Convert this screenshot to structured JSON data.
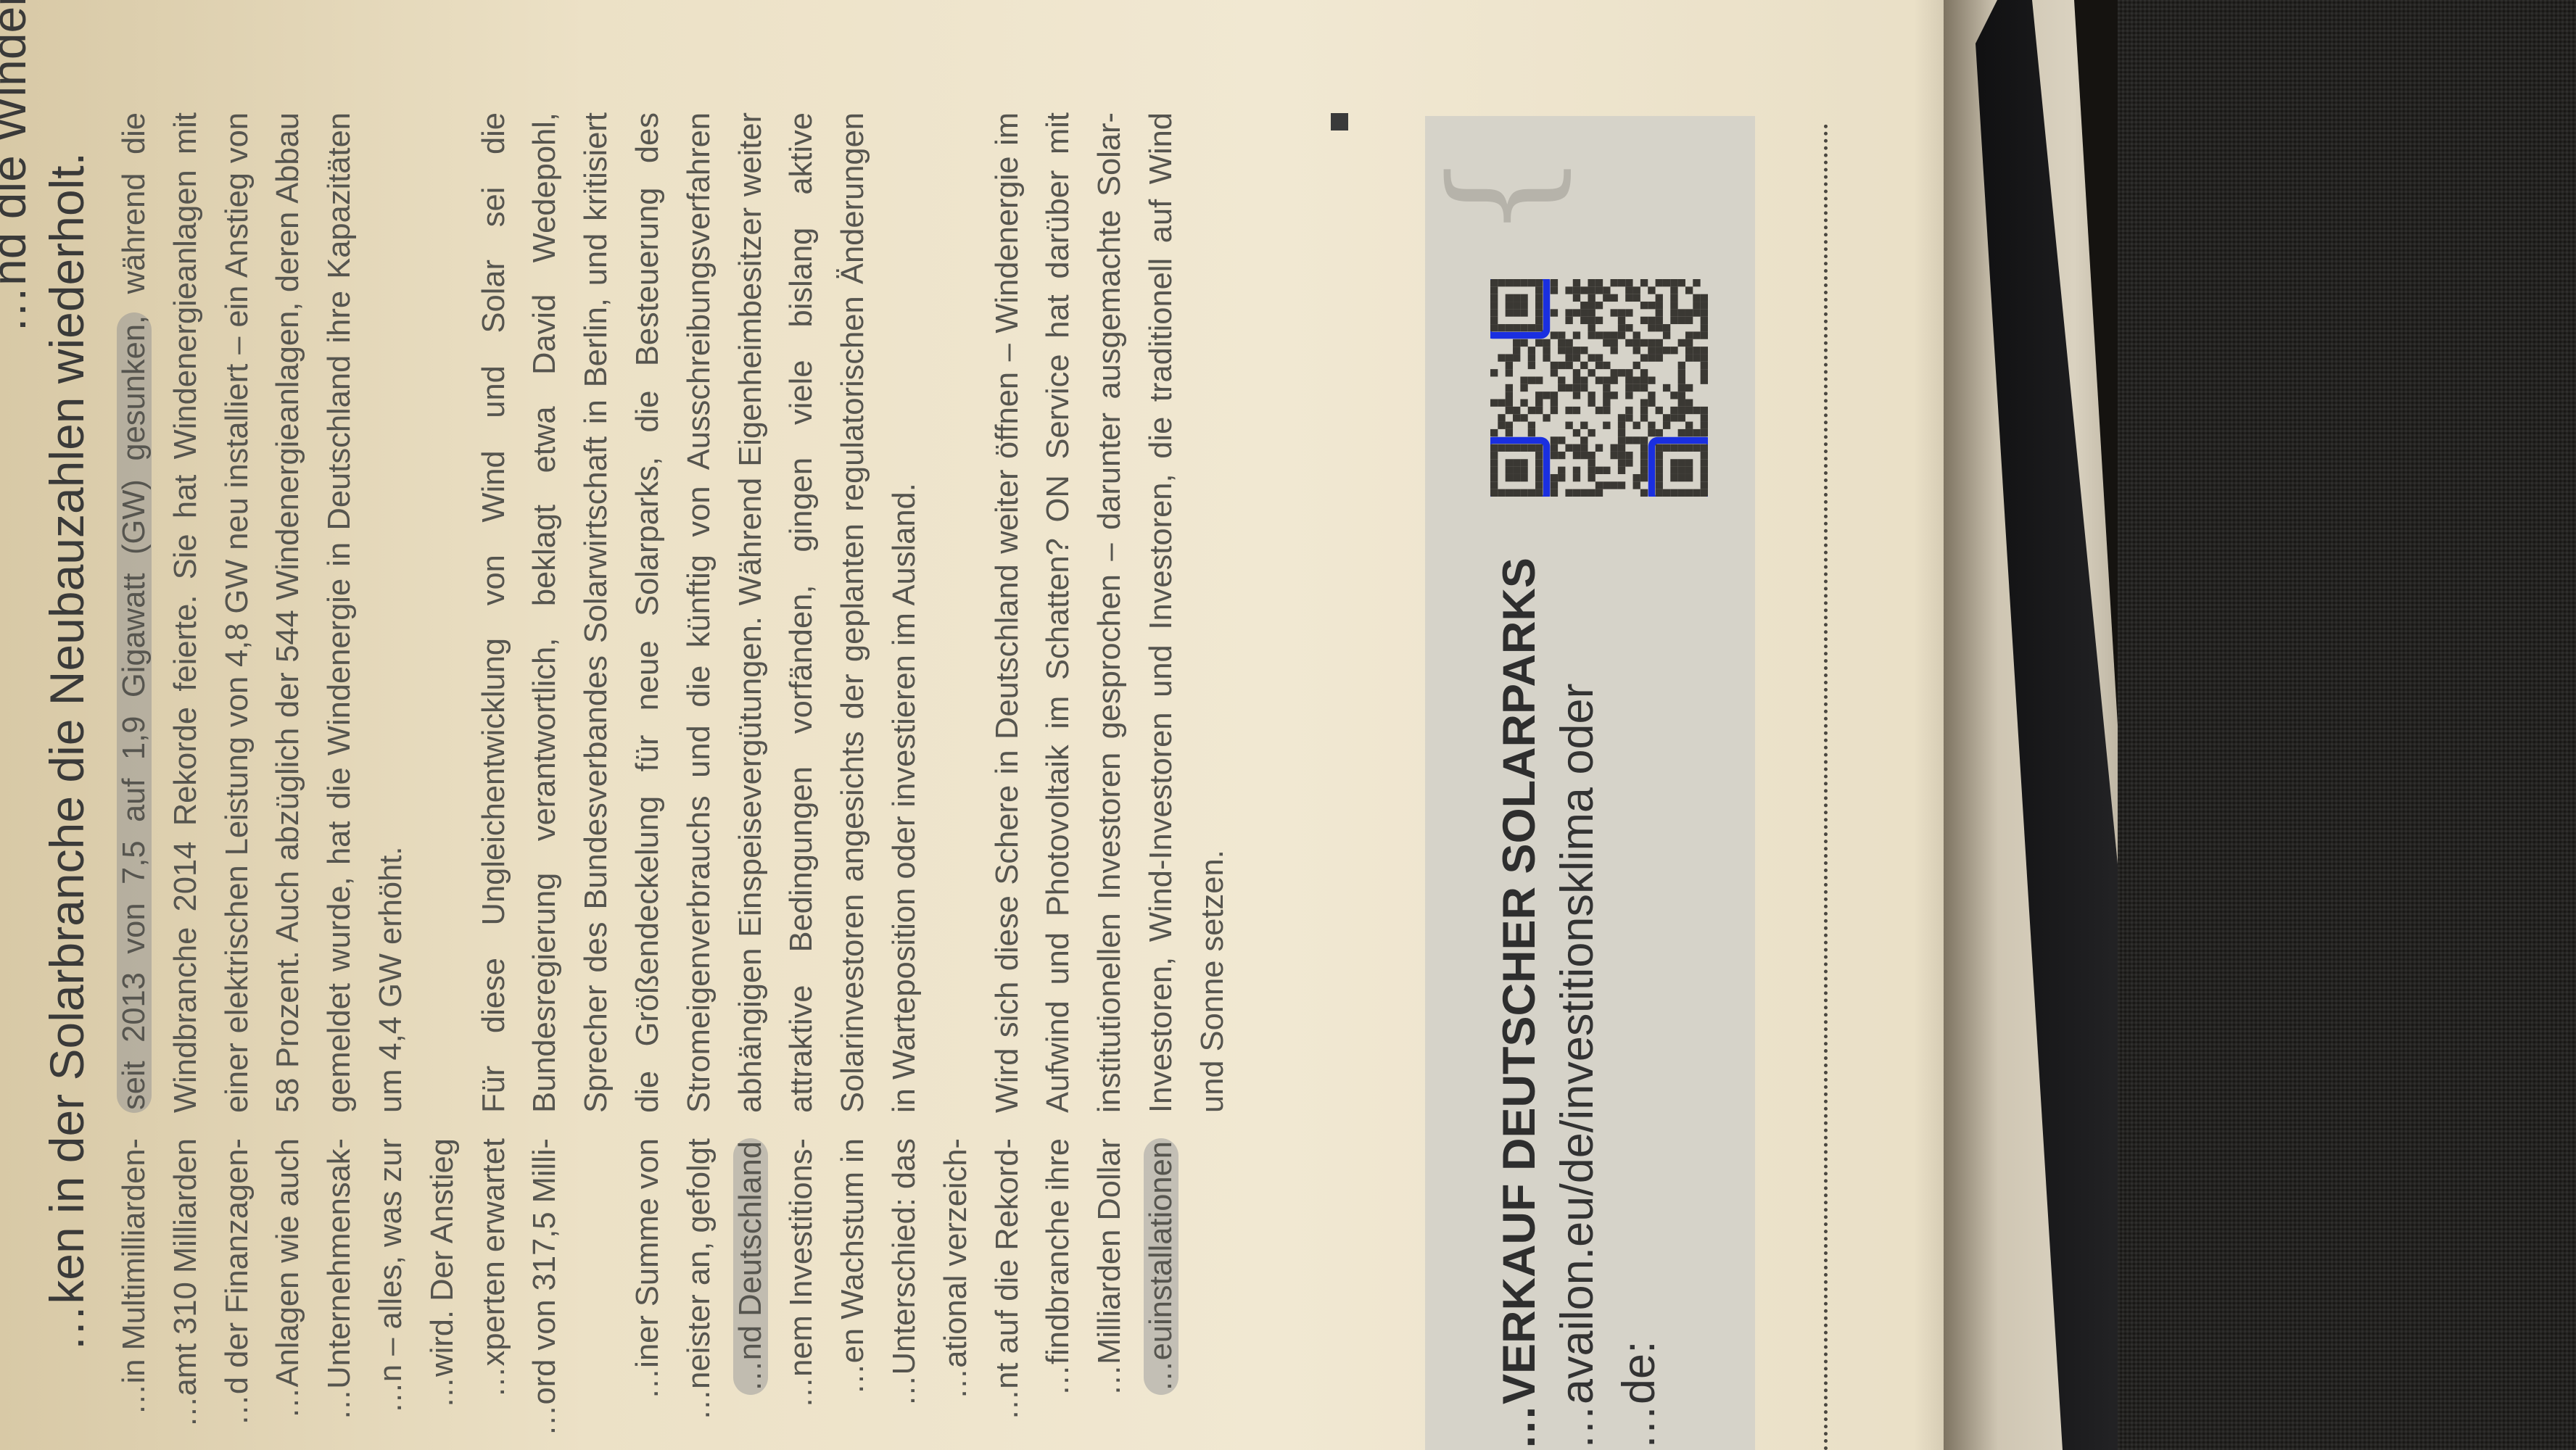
{
  "heading": {
    "line1": "…nd die Windenergiebranche in Deutsch-",
    "line2": "…ken in der Solarbranche die Neubauzahlen wiederholt."
  },
  "left_column": {
    "block1": [
      "…in Multimilliarden-",
      "…amt 310 Milliarden",
      "…d der Finanzagen-",
      "…Anlagen wie auch",
      "…Unternehmensak-",
      "…n – alles, was zur",
      "…wird. Der Anstieg",
      "…xperten erwartet",
      "…ord von 317,5 Milli-"
    ],
    "block2": [
      "…iner Summe von",
      "…neister an, gefolgt",
      "…nd Deutschland",
      "…nem Investitions-",
      "…en Wachstum in",
      "…Unterschied: das",
      "…ational verzeich-",
      "…nt auf die Rekord-",
      "…findbranche ihre",
      "…Milliarden Dollar",
      "…euinstallationen"
    ]
  },
  "right_column": {
    "para1_highlight": "seit 2013 von 7,5 auf 1,9 Gigawatt (GW) gesunken,",
    "para1_rest": " während die Windbranche 2014 Rekorde feierte. Sie hat Windenergieanlagen mit einer elektrischen Leistung von 4,8 GW neu installiert – ein Anstieg von 58 Prozent. Auch abzüglich der 544 Windenergieanlagen, deren Abbau gemeldet wurde, hat die Windenergie in Deutschland ihre Kapazitäten um 4,4 GW erhöht.",
    "para2": "Für diese Ungleichentwicklung von Wind und Solar sei die Bundesregierung verantwortlich, beklagt etwa David Wedepohl, Sprecher des Bundesverbandes Solarwirtschaft in Berlin, und kritisiert die Größendeckelung für neue Solarparks, die Besteuerung des Stromeigenverbrauchs und die künftig von Ausschreibungsverfahren abhängigen Einspeisevergütungen. Während Eigenheimbesitzer weiter attraktive Bedingungen vorfänden, gingen viele bislang aktive Solarinvestoren angesichts der geplanten regulatorischen Änderungen in Warteposition oder investieren im Ausland.",
    "para3": "Wird sich diese Schere in Deutschland weiter öffnen – Windenergie im Aufwind und Photovoltaik im Schatten? ON Service hat darüber mit institutionellen Investoren gesprochen – darunter ausgemachte Solar-Investoren, Wind-Investoren und Investoren, die traditionell auf Wind und Sonne setzen."
  },
  "infobox": {
    "title": "…VERKAUF DEUTSCHER SOLARPARKS",
    "link": "…availon.eu/de/investitionsklima oder",
    "note": "…de:"
  },
  "colors": {
    "paper": "#efe6cf",
    "box": "#d6d3c9",
    "highlight": "#8a8f98",
    "qr_finder_outline": "#1a2fe0"
  }
}
